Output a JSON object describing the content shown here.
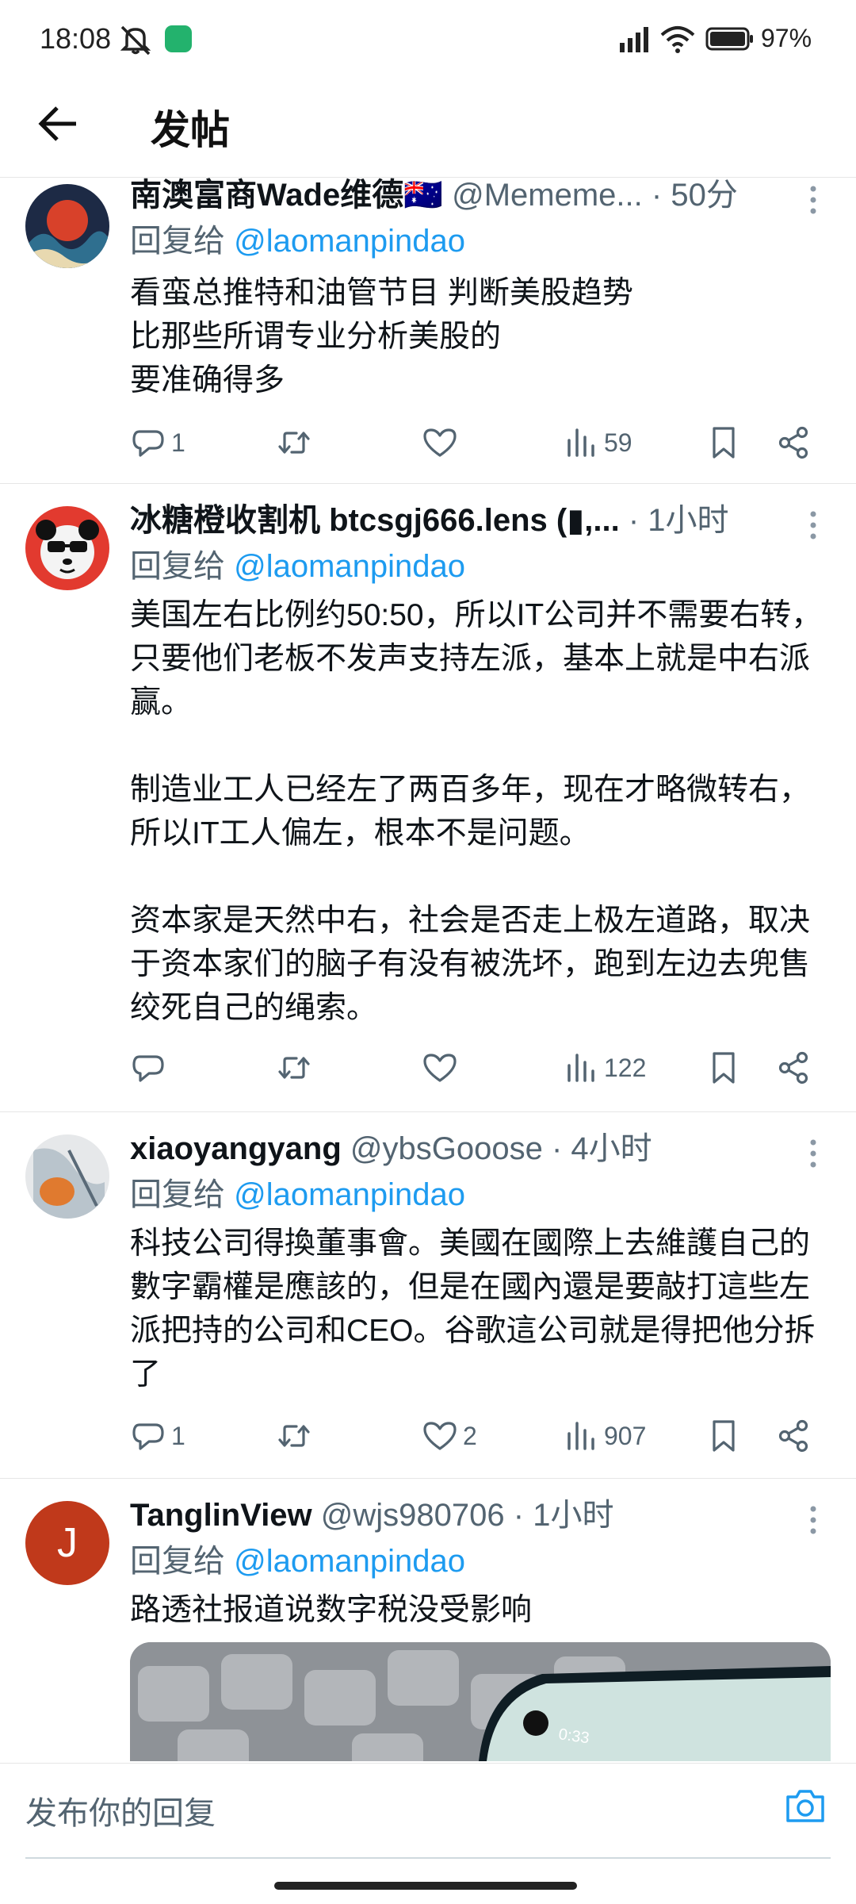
{
  "status": {
    "time": "18:08",
    "battery": "97%"
  },
  "header": {
    "title": "发帖"
  },
  "posts": [
    {
      "name": "南澳富商Wade维德🇦🇺",
      "handle": "@Mememe...",
      "time": "· 50分",
      "reply_prefix": "回复给",
      "reply_to": "@laomanpindao",
      "text": "看蛮总推特和油管节目 判断美股趋势\n比那些所谓专业分析美股的\n要准确得多",
      "replies": "1",
      "retweets": "",
      "likes": "",
      "views": "59"
    },
    {
      "name": "冰糖橙收割机 btcsgj666.lens (▮,...",
      "handle": "",
      "time": "· 1小时",
      "reply_prefix": "回复给",
      "reply_to": "@laomanpindao",
      "text": "美国左右比例约50:50，所以IT公司并不需要右转，只要他们老板不发声支持左派，基本上就是中右派赢。\n\n制造业工人已经左了两百多年，现在才略微转右，所以IT工人偏左，根本不是问题。\n\n资本家是天然中右，社会是否走上极左道路，取决于资本家们的脑子有没有被洗坏，跑到左边去兜售绞死自己的绳索。",
      "replies": "",
      "retweets": "",
      "likes": "",
      "views": "122"
    },
    {
      "name": "xiaoyangyang",
      "handle": "@ybsGooose",
      "time": "· 4小时",
      "reply_prefix": "回复给",
      "reply_to": "@laomanpindao",
      "text": "科技公司得換董事會。美國在國際上去維護自己的數字霸權是應該的，但是在國內還是要敲打這些左派把持的公司和CEO。谷歌這公司就是得把他分拆了",
      "replies": "1",
      "retweets": "",
      "likes": "2",
      "views": "907"
    },
    {
      "name": "TanglinView",
      "handle": "@wjs980706",
      "time": "· 1小时",
      "reply_prefix": "回复给",
      "reply_to": "@laomanpindao",
      "text": "路透社报道说数字税没受影响",
      "avatar_letter": "J",
      "media_timestamp": "0:33"
    }
  ],
  "composer": {
    "placeholder": "发布你的回复"
  },
  "colors": {
    "accent": "#1d9bf0",
    "muted": "#536471",
    "text": "#0f1419",
    "avatar_j": "#c0391b"
  }
}
